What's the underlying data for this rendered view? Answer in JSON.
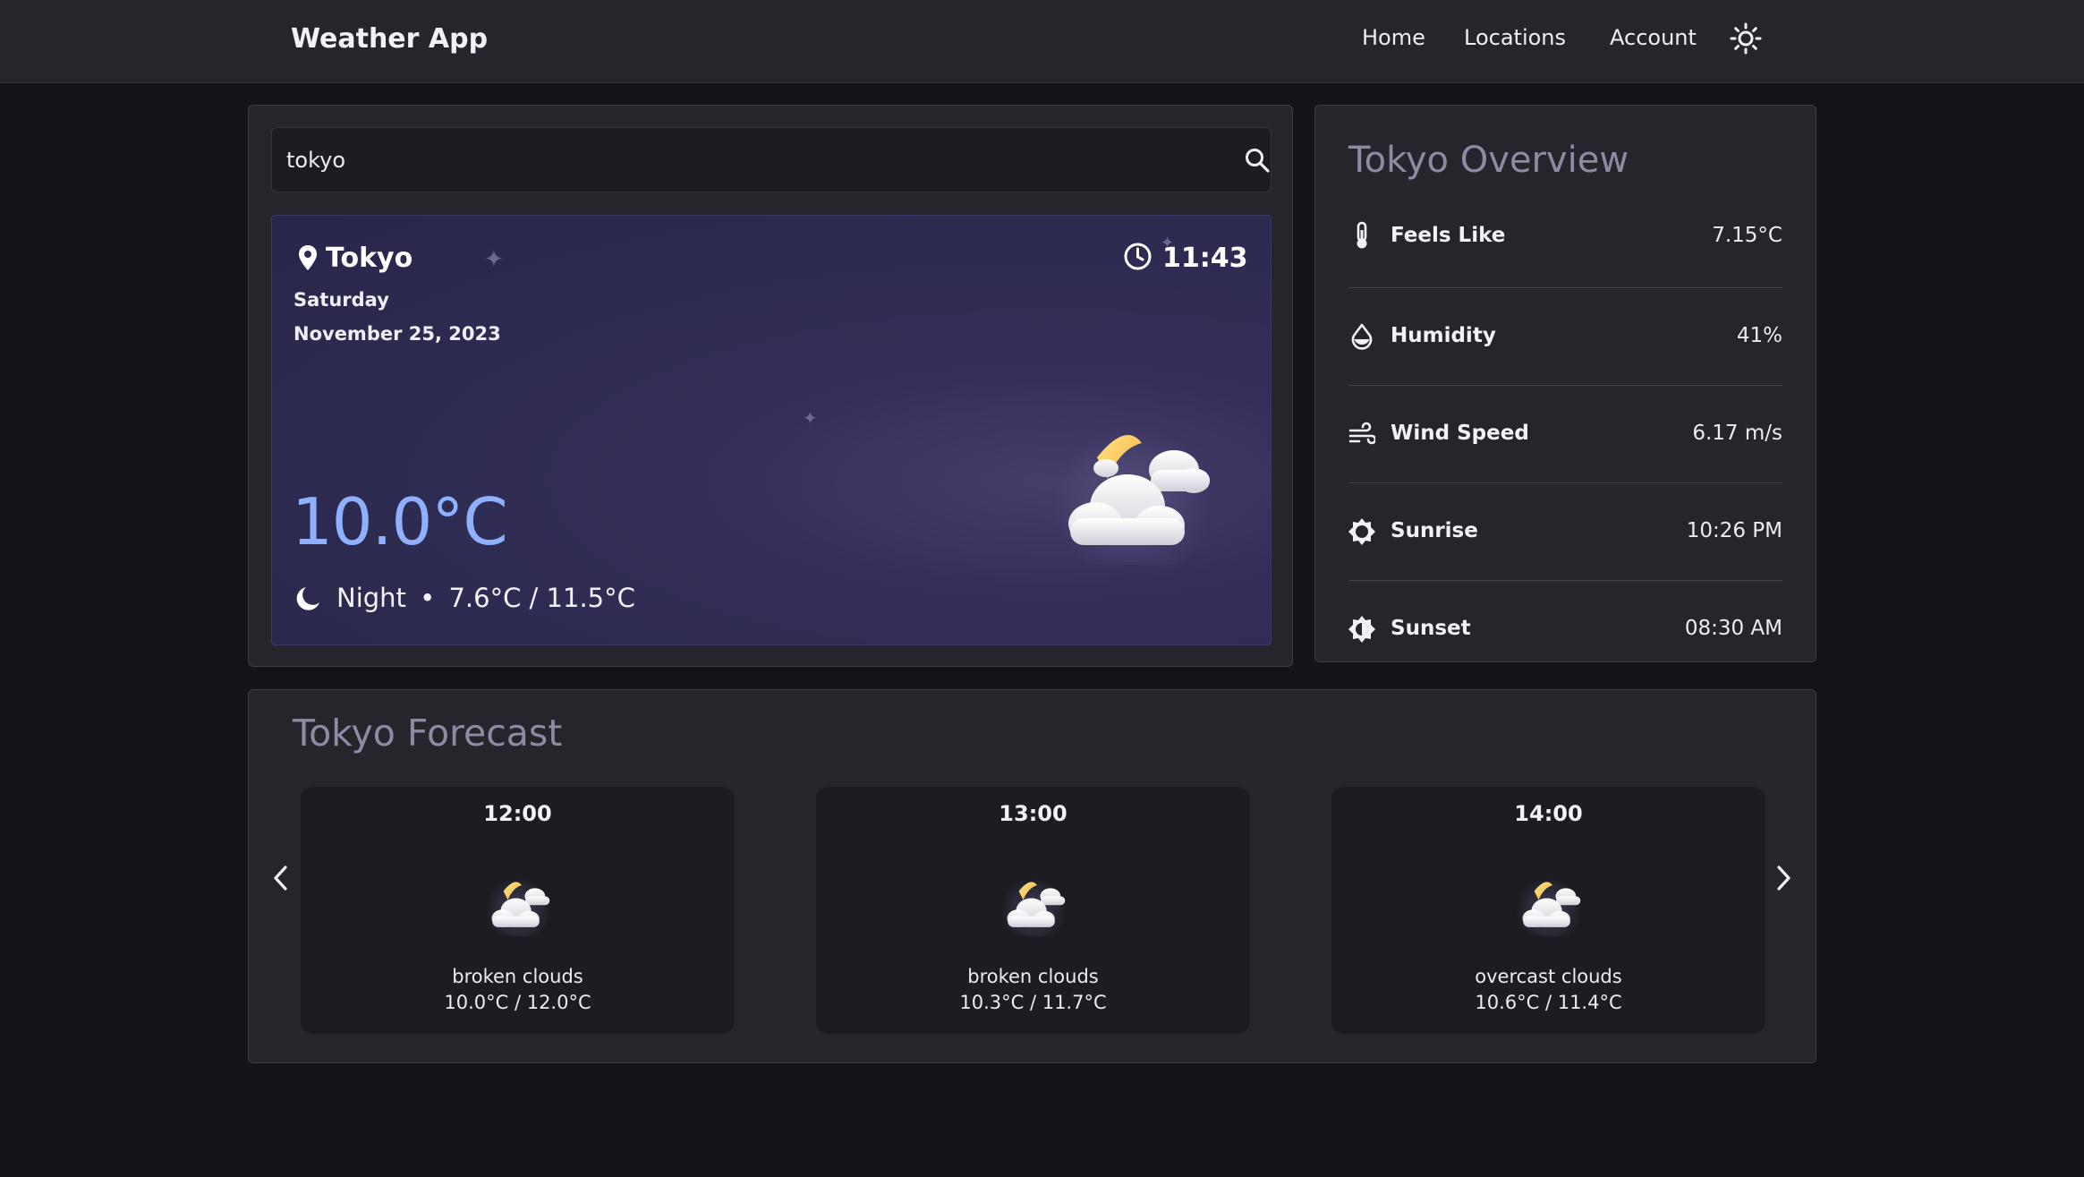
{
  "header": {
    "brand": "Weather App",
    "nav": [
      "Home",
      "Locations",
      "Account"
    ],
    "theme_toggle_icon": "sun-icon"
  },
  "search": {
    "value": "tokyo",
    "icon": "search-icon"
  },
  "current": {
    "city": "Tokyo",
    "day": "Saturday",
    "date": "November 25, 2023",
    "time": "11:43",
    "temperature": "10.0°C",
    "period": "Night",
    "separator": "•",
    "min_max": "7.6°C / 11.5°C",
    "icon": "partly-cloudy-night-icon",
    "accent_color": "#8fb0ff"
  },
  "overview": {
    "title": "Tokyo Overview",
    "rows": [
      {
        "label": "Feels Like",
        "value": "7.15°C",
        "icon": "thermometer-icon"
      },
      {
        "label": "Humidity",
        "value": "41%",
        "icon": "humidity-drop-icon"
      },
      {
        "label": "Wind Speed",
        "value": "6.17 m/s",
        "icon": "wind-icon"
      },
      {
        "label": "Sunrise",
        "value": "10:26 PM",
        "icon": "sunrise-icon"
      },
      {
        "label": "Sunset",
        "value": "08:30 AM",
        "icon": "sunset-icon"
      }
    ]
  },
  "forecast": {
    "title": "Tokyo Forecast",
    "items": [
      {
        "time": "12:00",
        "description": "broken clouds",
        "range": "10.0°C / 12.0°C",
        "icon": "partly-cloudy-night-icon"
      },
      {
        "time": "13:00",
        "description": "broken clouds",
        "range": "10.3°C / 11.7°C",
        "icon": "partly-cloudy-night-icon"
      },
      {
        "time": "14:00",
        "description": "overcast clouds",
        "range": "10.6°C / 11.4°C",
        "icon": "partly-cloudy-night-icon"
      }
    ]
  }
}
